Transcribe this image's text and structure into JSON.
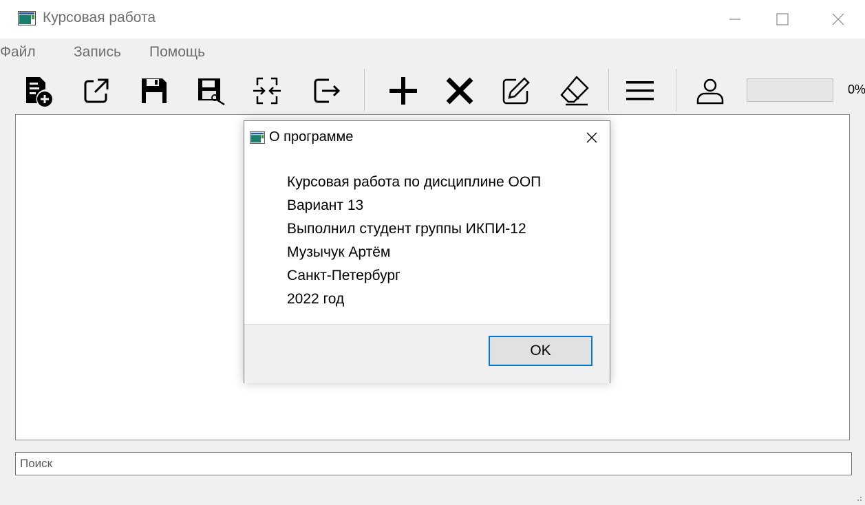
{
  "window": {
    "title": "Курсовая работа"
  },
  "menu": {
    "items": [
      "Файл",
      "Запись",
      "Помощь"
    ]
  },
  "toolbar": {
    "buttons": [
      "new-file-icon",
      "export-icon",
      "save-icon",
      "save-as-icon",
      "merge-icon",
      "exit-icon",
      "add-icon",
      "delete-icon",
      "edit-icon",
      "eraser-icon",
      "menu-icon",
      "user-icon"
    ],
    "progress_value": 0,
    "progress_label": "0%"
  },
  "search": {
    "placeholder": "Поиск",
    "value": ""
  },
  "dialog": {
    "title": "О программе",
    "lines": [
      "Курсовая работа по дисциплине ООП",
      "Вариант 13",
      "Выполнил студент группы ИКПИ-12",
      "Музычук Артём",
      "Санкт-Петербург",
      "2022 год"
    ],
    "ok_label": "OK"
  },
  "colors": {
    "accent": "#0078d7",
    "icon_teal": "#1b7f6e",
    "icon_green": "#3c9b3c",
    "background": "#f0f0f0"
  }
}
